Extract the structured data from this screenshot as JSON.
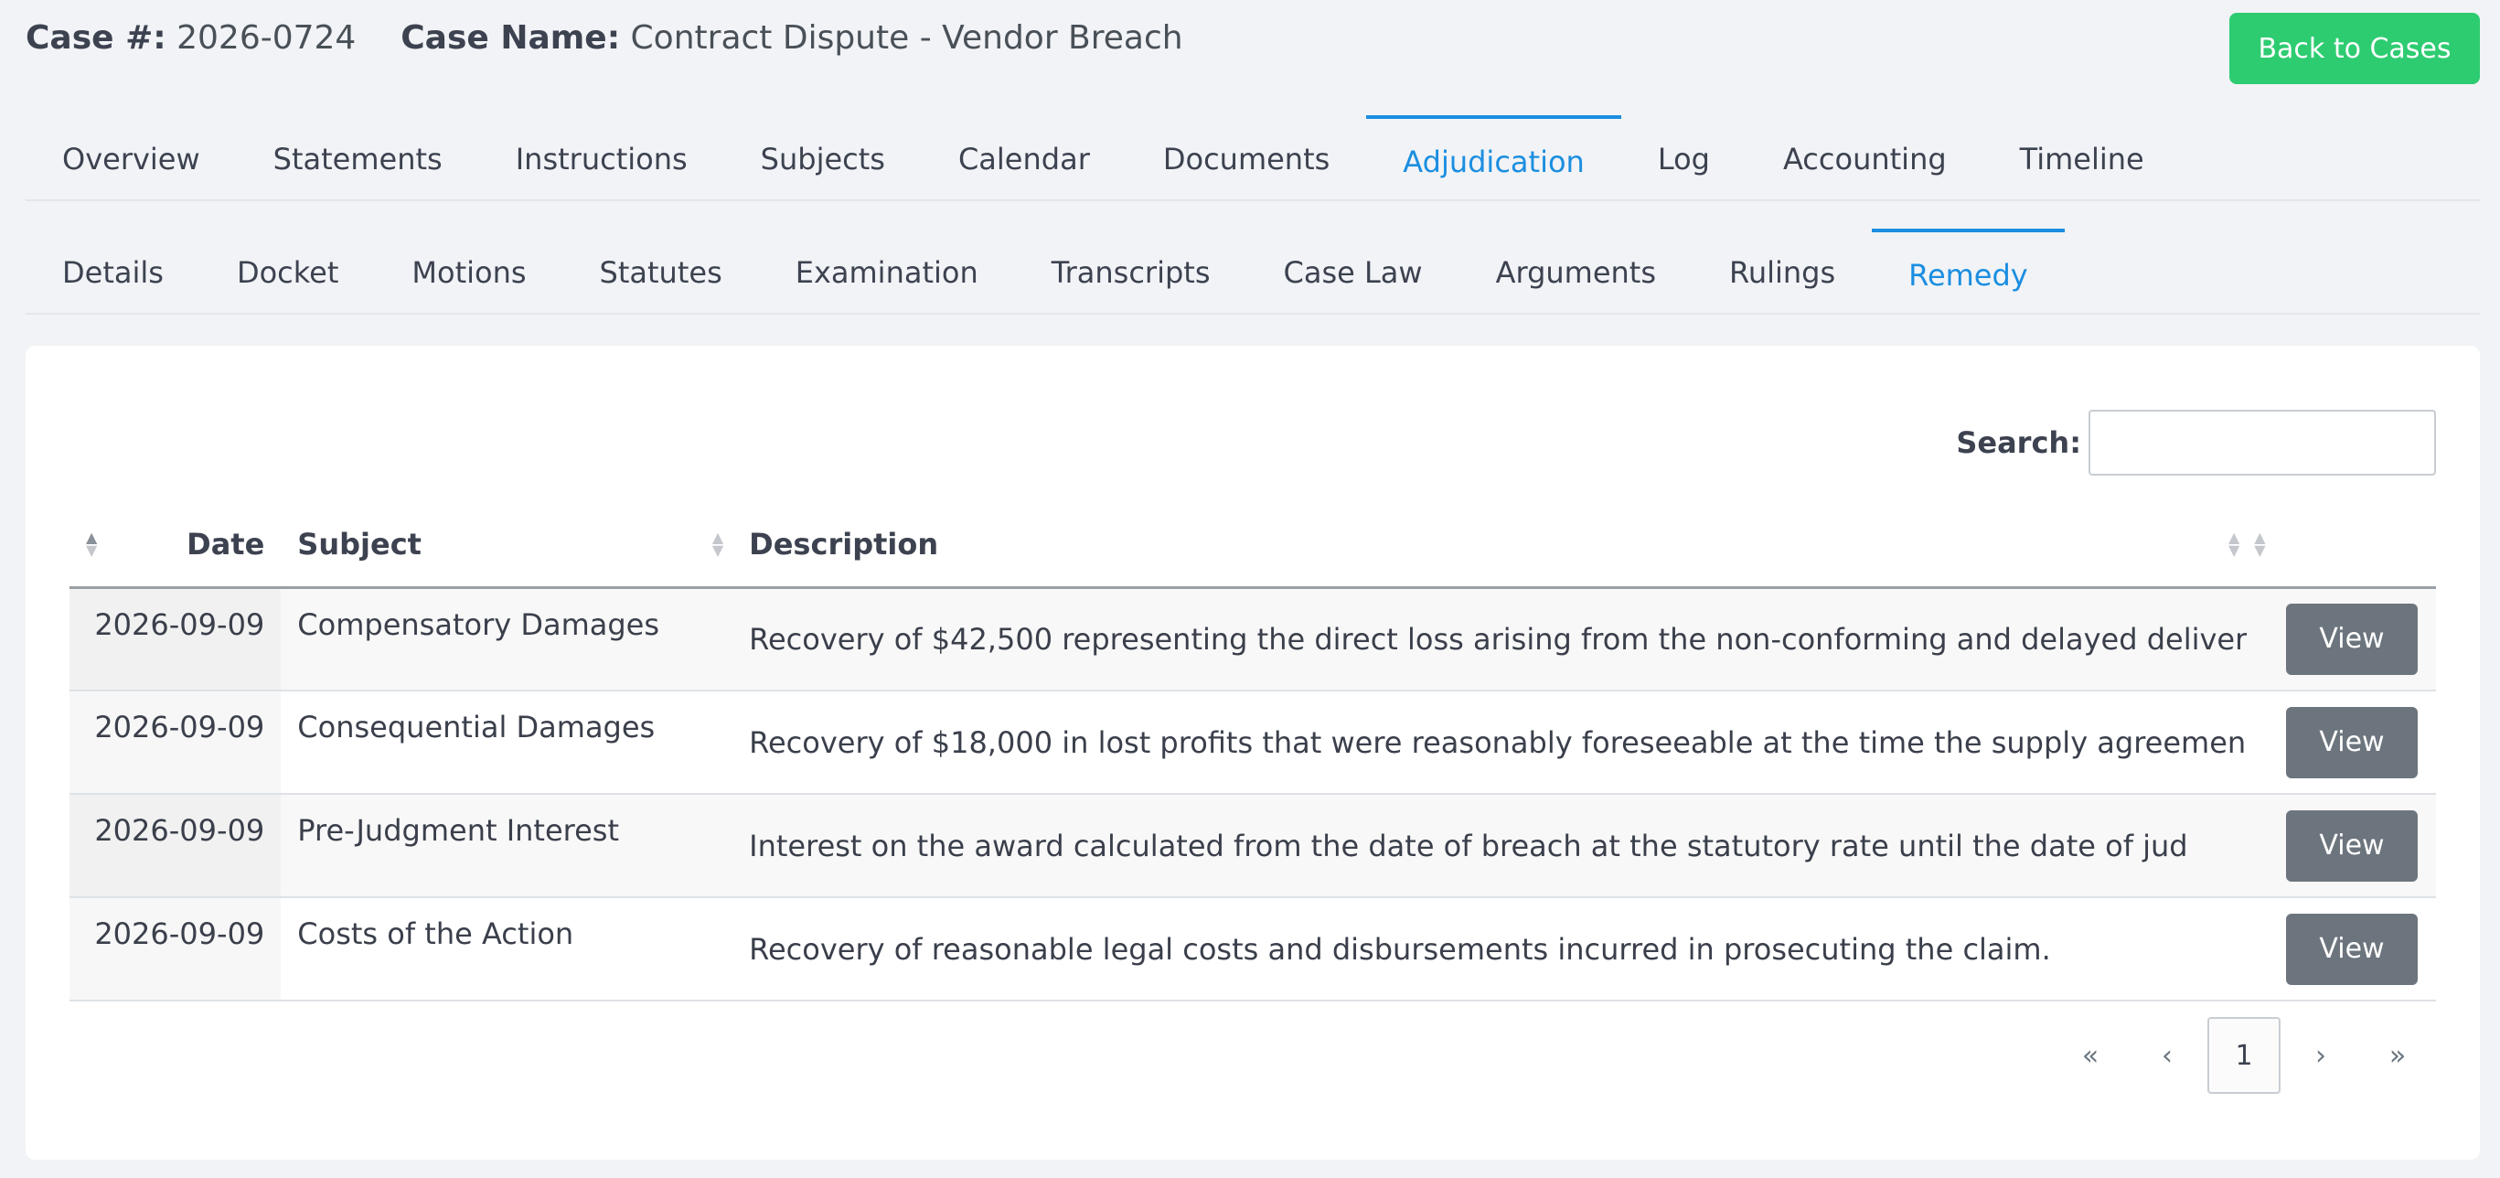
{
  "header": {
    "case_number_label": "Case #:",
    "case_number": "2026-0724",
    "case_name_label": "Case Name:",
    "case_name": "Contract Dispute - Vendor Breach",
    "back_button": "Back to Cases"
  },
  "primary_tabs": [
    {
      "label": "Overview"
    },
    {
      "label": "Statements"
    },
    {
      "label": "Instructions"
    },
    {
      "label": "Subjects"
    },
    {
      "label": "Calendar"
    },
    {
      "label": "Documents"
    },
    {
      "label": "Adjudication",
      "active": true
    },
    {
      "label": "Log"
    },
    {
      "label": "Accounting"
    },
    {
      "label": "Timeline"
    }
  ],
  "secondary_tabs": [
    {
      "label": "Details"
    },
    {
      "label": "Docket"
    },
    {
      "label": "Motions"
    },
    {
      "label": "Statutes"
    },
    {
      "label": "Examination"
    },
    {
      "label": "Transcripts"
    },
    {
      "label": "Case Law"
    },
    {
      "label": "Arguments"
    },
    {
      "label": "Rulings"
    },
    {
      "label": "Remedy",
      "active": true
    }
  ],
  "search": {
    "label": "Search:",
    "value": "",
    "placeholder": ""
  },
  "table": {
    "columns": {
      "date": "Date",
      "subject": "Subject",
      "description": "Description"
    },
    "rows": [
      {
        "date": "2026-09-09",
        "subject": "Compensatory Damages",
        "description": "Recovery of $42,500 representing the direct loss arising from the non-conforming and delayed deliver",
        "action": "View"
      },
      {
        "date": "2026-09-09",
        "subject": "Consequential Damages",
        "description": "Recovery of $18,000 in lost profits that were reasonably foreseeable at the time the supply agreemen",
        "action": "View"
      },
      {
        "date": "2026-09-09",
        "subject": "Pre-Judgment Interest",
        "description": "Interest on the award calculated from the date of breach at the statutory rate until the date of jud",
        "action": "View"
      },
      {
        "date": "2026-09-09",
        "subject": "Costs of the Action",
        "description": "Recovery of reasonable legal costs and disbursements incurred in prosecuting the claim.",
        "action": "View"
      }
    ]
  },
  "pagination": {
    "first": "«",
    "prev": "‹",
    "current": "1",
    "next": "›",
    "last": "»"
  },
  "colors": {
    "accent": "#1b8ee0",
    "back_button": "#2ecc71",
    "view_button": "#6c757d"
  }
}
